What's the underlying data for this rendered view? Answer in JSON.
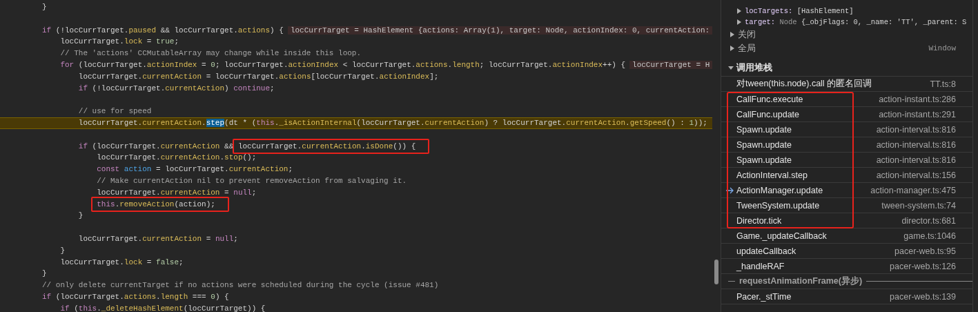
{
  "editor": {
    "lines": [
      {
        "kind": "code",
        "current": false,
        "parts": [
          {
            "kind": "code",
            "tokens": [
              {
                "kind": "pl",
                "t": "}"
              }
            ]
          }
        ]
      },
      {
        "kind": "blank"
      },
      {
        "kind": "code",
        "current": false,
        "parts": [
          {
            "kind": "code",
            "tokens": [
              {
                "kind": "kw",
                "t": "if"
              },
              {
                "kind": "pl",
                "t": " (!locCurrTarget."
              },
              {
                "kind": "prop",
                "t": "paused"
              },
              {
                "kind": "pl",
                "t": " && locCurrTarget."
              },
              {
                "kind": "prop",
                "t": "actions"
              },
              {
                "kind": "pl",
                "t": ") {"
              }
            ]
          },
          {
            "kind": "inline-value",
            "text": "locCurrTarget = HashElement {actions: Array(1), target: Node, actionIndex: 0, currentAction:"
          }
        ]
      },
      {
        "kind": "code",
        "current": false,
        "parts": [
          {
            "kind": "code",
            "tokens": [
              {
                "kind": "pl",
                "t": "    locCurrTarget."
              },
              {
                "kind": "prop",
                "t": "lock"
              },
              {
                "kind": "pl",
                "t": " = "
              },
              {
                "kind": "bool",
                "t": "true"
              },
              {
                "kind": "pl",
                "t": ";"
              }
            ]
          }
        ]
      },
      {
        "kind": "code",
        "current": false,
        "parts": [
          {
            "kind": "code",
            "tokens": [
              {
                "kind": "com",
                "t": "    // The 'actions' CCMutableArray may change while inside this loop."
              }
            ]
          }
        ]
      },
      {
        "kind": "code",
        "current": false,
        "parts": [
          {
            "kind": "code",
            "tokens": [
              {
                "kind": "kw",
                "t": "    for"
              },
              {
                "kind": "pl",
                "t": " (locCurrTarget."
              },
              {
                "kind": "prop",
                "t": "actionIndex"
              },
              {
                "kind": "pl",
                "t": " = "
              },
              {
                "kind": "num",
                "t": "0"
              },
              {
                "kind": "pl",
                "t": "; locCurrTarget."
              },
              {
                "kind": "prop",
                "t": "actionIndex"
              },
              {
                "kind": "pl",
                "t": " < locCurrTarget."
              },
              {
                "kind": "prop",
                "t": "actions"
              },
              {
                "kind": "pl",
                "t": "."
              },
              {
                "kind": "prop",
                "t": "length"
              },
              {
                "kind": "pl",
                "t": "; locCurrTarget."
              },
              {
                "kind": "prop",
                "t": "actionIndex"
              },
              {
                "kind": "pl",
                "t": "++) {"
              }
            ]
          },
          {
            "kind": "inline-value",
            "text": "locCurrTarget = H"
          }
        ]
      },
      {
        "kind": "code",
        "current": false,
        "parts": [
          {
            "kind": "code",
            "tokens": [
              {
                "kind": "pl",
                "t": "        locCurrTarget."
              },
              {
                "kind": "prop",
                "t": "currentAction"
              },
              {
                "kind": "pl",
                "t": " = locCurrTarget."
              },
              {
                "kind": "prop",
                "t": "actions"
              },
              {
                "kind": "pl",
                "t": "[locCurrTarget."
              },
              {
                "kind": "prop",
                "t": "actionIndex"
              },
              {
                "kind": "pl",
                "t": "];"
              }
            ]
          }
        ]
      },
      {
        "kind": "code",
        "current": false,
        "parts": [
          {
            "kind": "code",
            "tokens": [
              {
                "kind": "kw",
                "t": "        if"
              },
              {
                "kind": "pl",
                "t": " (!locCurrTarget."
              },
              {
                "kind": "prop",
                "t": "currentAction"
              },
              {
                "kind": "pl",
                "t": ") "
              },
              {
                "kind": "kw",
                "t": "continue"
              },
              {
                "kind": "pl",
                "t": ";"
              }
            ]
          }
        ]
      },
      {
        "kind": "blank"
      },
      {
        "kind": "code",
        "current": false,
        "parts": [
          {
            "kind": "code",
            "tokens": [
              {
                "kind": "com",
                "t": "        // use for speed"
              }
            ]
          }
        ]
      },
      {
        "kind": "code",
        "current": true,
        "parts": [
          {
            "kind": "code",
            "tokens": [
              {
                "kind": "pl",
                "t": "        locCurrTarget."
              },
              {
                "kind": "prop",
                "t": "currentAction"
              },
              {
                "kind": "pl",
                "t": "."
              },
              {
                "kind": "call",
                "t": "step"
              },
              {
                "kind": "pl",
                "t": "(dt * ("
              },
              {
                "kind": "kw",
                "t": "this"
              },
              {
                "kind": "pl",
                "t": "."
              },
              {
                "kind": "prop",
                "t": "_isActionInternal"
              },
              {
                "kind": "pl",
                "t": "(locCurrTarget."
              },
              {
                "kind": "prop",
                "t": "currentAction"
              },
              {
                "kind": "pl",
                "t": ") ? locCurrTarget."
              },
              {
                "kind": "prop",
                "t": "currentAction"
              },
              {
                "kind": "pl",
                "t": "."
              },
              {
                "kind": "prop",
                "t": "getSpeed"
              },
              {
                "kind": "pl",
                "t": "() : "
              },
              {
                "kind": "num",
                "t": "1"
              },
              {
                "kind": "pl",
                "t": "));"
              }
            ]
          }
        ]
      },
      {
        "kind": "blank"
      },
      {
        "kind": "code",
        "current": false,
        "parts": [
          {
            "kind": "code",
            "tokens": [
              {
                "kind": "kw",
                "t": "        if"
              },
              {
                "kind": "pl",
                "t": " (locCurrTarget."
              },
              {
                "kind": "prop",
                "t": "currentAction"
              },
              {
                "kind": "pl",
                "t": " &&"
              }
            ]
          },
          {
            "kind": "annotated-code",
            "tokens": [
              {
                "kind": "pl",
                "t": " locCurrTarget."
              },
              {
                "kind": "prop",
                "t": "currentAction"
              },
              {
                "kind": "pl",
                "t": "."
              },
              {
                "kind": "prop",
                "t": "isDone"
              },
              {
                "kind": "pl",
                "t": "()) {"
              }
            ]
          }
        ]
      },
      {
        "kind": "code",
        "current": false,
        "parts": [
          {
            "kind": "code",
            "tokens": [
              {
                "kind": "pl",
                "t": "            locCurrTarget."
              },
              {
                "kind": "prop",
                "t": "currentAction"
              },
              {
                "kind": "pl",
                "t": "."
              },
              {
                "kind": "prop",
                "t": "stop"
              },
              {
                "kind": "pl",
                "t": "();"
              }
            ]
          }
        ]
      },
      {
        "kind": "code",
        "current": false,
        "parts": [
          {
            "kind": "code",
            "tokens": [
              {
                "kind": "kw",
                "t": "            const"
              },
              {
                "kind": "var",
                "t": " action"
              },
              {
                "kind": "pl",
                "t": " = locCurrTarget."
              },
              {
                "kind": "prop",
                "t": "currentAction"
              },
              {
                "kind": "pl",
                "t": ";"
              }
            ]
          }
        ]
      },
      {
        "kind": "code",
        "current": false,
        "parts": [
          {
            "kind": "code",
            "tokens": [
              {
                "kind": "com",
                "t": "            // Make currentAction nil to prevent removeAction from salvaging it."
              }
            ]
          }
        ]
      },
      {
        "kind": "code",
        "current": false,
        "parts": [
          {
            "kind": "code",
            "tokens": [
              {
                "kind": "pl",
                "t": "            locCurrTarget."
              },
              {
                "kind": "prop",
                "t": "currentAction"
              },
              {
                "kind": "pl",
                "t": " = "
              },
              {
                "kind": "kw",
                "t": "null"
              },
              {
                "kind": "pl",
                "t": ";"
              }
            ]
          }
        ]
      },
      {
        "kind": "code",
        "current": false,
        "parts": [
          {
            "kind": "annotated-code",
            "tokens": [
              {
                "kind": "kw",
                "t": "            this"
              },
              {
                "kind": "pl",
                "t": "."
              },
              {
                "kind": "prop",
                "t": "removeAction"
              },
              {
                "kind": "pl",
                "t": "(action);"
              }
            ]
          }
        ]
      },
      {
        "kind": "code",
        "current": false,
        "parts": [
          {
            "kind": "code",
            "tokens": [
              {
                "kind": "pl",
                "t": "        }"
              }
            ]
          }
        ]
      },
      {
        "kind": "blank"
      },
      {
        "kind": "code",
        "current": false,
        "parts": [
          {
            "kind": "code",
            "tokens": [
              {
                "kind": "pl",
                "t": "        locCurrTarget."
              },
              {
                "kind": "prop",
                "t": "currentAction"
              },
              {
                "kind": "pl",
                "t": " = "
              },
              {
                "kind": "kw",
                "t": "null"
              },
              {
                "kind": "pl",
                "t": ";"
              }
            ]
          }
        ]
      },
      {
        "kind": "code",
        "current": false,
        "parts": [
          {
            "kind": "code",
            "tokens": [
              {
                "kind": "pl",
                "t": "    }"
              }
            ]
          }
        ]
      },
      {
        "kind": "code",
        "current": false,
        "parts": [
          {
            "kind": "code",
            "tokens": [
              {
                "kind": "pl",
                "t": "    locCurrTarget."
              },
              {
                "kind": "prop",
                "t": "lock"
              },
              {
                "kind": "pl",
                "t": " = "
              },
              {
                "kind": "bool",
                "t": "false"
              },
              {
                "kind": "pl",
                "t": ";"
              }
            ]
          }
        ]
      },
      {
        "kind": "code",
        "current": false,
        "parts": [
          {
            "kind": "code",
            "tokens": [
              {
                "kind": "pl",
                "t": "}"
              }
            ]
          }
        ]
      },
      {
        "kind": "code",
        "current": false,
        "parts": [
          {
            "kind": "code",
            "tokens": [
              {
                "kind": "com",
                "t": "// only delete currentTarget if no actions were scheduled during the cycle (issue #481)"
              }
            ]
          }
        ]
      },
      {
        "kind": "code",
        "current": false,
        "parts": [
          {
            "kind": "code",
            "tokens": [
              {
                "kind": "kw",
                "t": "if"
              },
              {
                "kind": "pl",
                "t": " (locCurrTarget."
              },
              {
                "kind": "prop",
                "t": "actions"
              },
              {
                "kind": "pl",
                "t": "."
              },
              {
                "kind": "prop",
                "t": "length"
              },
              {
                "kind": "pl",
                "t": " === "
              },
              {
                "kind": "num",
                "t": "0"
              },
              {
                "kind": "pl",
                "t": ") {"
              }
            ]
          }
        ]
      },
      {
        "kind": "code",
        "current": false,
        "parts": [
          {
            "kind": "code",
            "tokens": [
              {
                "kind": "kw",
                "t": "    if"
              },
              {
                "kind": "pl",
                "t": " ("
              },
              {
                "kind": "kw",
                "t": "this"
              },
              {
                "kind": "pl",
                "t": "."
              },
              {
                "kind": "prop",
                "t": "_deleteHashElement"
              },
              {
                "kind": "pl",
                "t": "(locCurrTarget)) {"
              }
            ]
          }
        ]
      }
    ]
  },
  "debugger": {
    "scope_properties": [
      {
        "key": "locTargets:",
        "value": "[HashElement]",
        "expanded": false
      },
      {
        "key": "target:",
        "type": "Node",
        "value": "{_objFlags: 0, _name: 'TT', _parent: S",
        "expanded": false
      }
    ],
    "scopes": [
      {
        "title": "关闭",
        "expanded": false
      },
      {
        "title": "全局",
        "expanded": false,
        "value": "Window"
      }
    ],
    "call_stack": {
      "title": "调用堆栈",
      "expanded": true,
      "items": [
        {
          "kind": "frame",
          "name": "对tween(this.node).call 的匿名回调",
          "location": "TT.ts:8",
          "selected": false
        },
        {
          "kind": "annotated-group",
          "frames": [
            {
              "name": "CallFunc.execute",
              "location": "action-instant.ts:286",
              "selected": false
            },
            {
              "name": "CallFunc.update",
              "location": "action-instant.ts:291",
              "selected": false
            },
            {
              "name": "Spawn.update",
              "location": "action-interval.ts:816",
              "selected": false
            },
            {
              "name": "Spawn.update",
              "location": "action-interval.ts:816",
              "selected": false
            },
            {
              "name": "Spawn.update",
              "location": "action-interval.ts:816",
              "selected": false
            },
            {
              "name": "ActionInterval.step",
              "location": "action-interval.ts:156",
              "selected": false
            },
            {
              "name": "ActionManager.update",
              "location": "action-manager.ts:475",
              "selected": true
            },
            {
              "name": "TweenSystem.update",
              "location": "tween-system.ts:74",
              "selected": false
            },
            {
              "name": "Director.tick",
              "location": "director.ts:681",
              "selected": false
            }
          ]
        },
        {
          "kind": "frame",
          "name": "Game._updateCallback",
          "location": "game.ts:1046",
          "selected": false
        },
        {
          "kind": "frame",
          "name": "updateCallback",
          "location": "pacer-web.ts:95",
          "selected": false
        },
        {
          "kind": "frame",
          "name": "_handleRAF",
          "location": "pacer-web.ts:126",
          "selected": false
        },
        {
          "kind": "async-separator",
          "label": "requestAnimationFrame(异步)"
        },
        {
          "kind": "frame",
          "name": "Pacer._stTime",
          "location": "pacer-web.ts:139",
          "selected": false
        }
      ]
    }
  }
}
